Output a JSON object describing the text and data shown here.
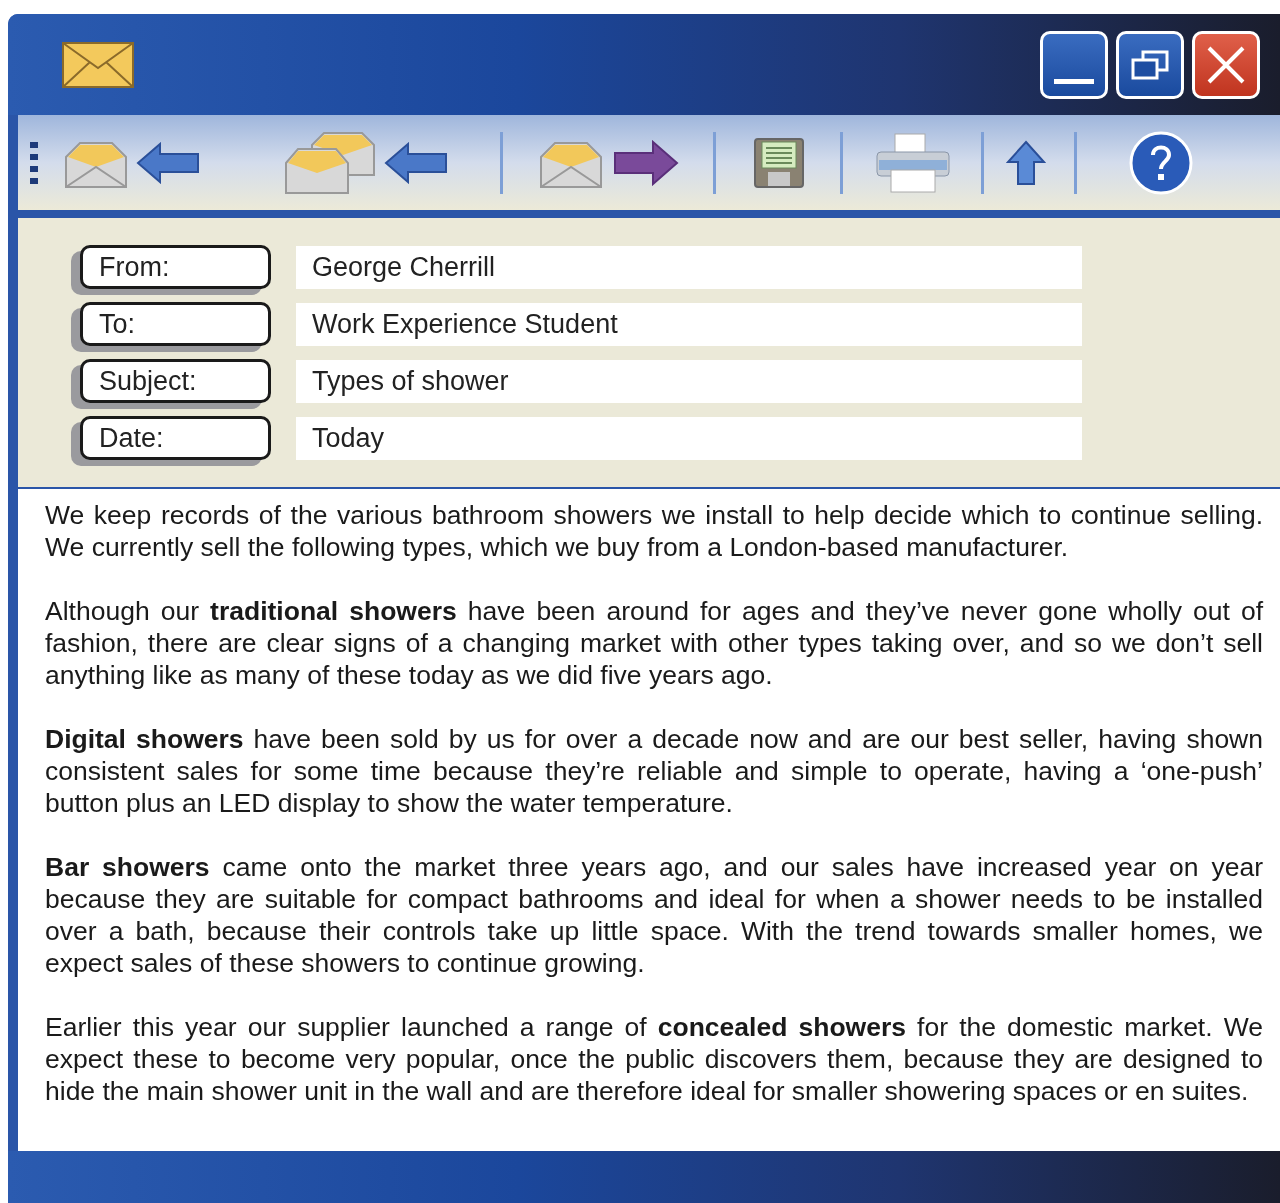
{
  "header_fields": [
    {
      "label": "From:",
      "value": "George Cherrill"
    },
    {
      "label": "To:",
      "value": "Work Experience Student"
    },
    {
      "label": "Subject:",
      "value": "Types of shower"
    },
    {
      "label": "Date:",
      "value": "Today"
    }
  ],
  "message": {
    "paragraphs": [
      "We keep records of the various bathroom showers we install to help decide which to continue selling. We currently sell the following types, which we buy from a London-based manufacturer.",
      "Although our **traditional showers** have been around for ages and they’ve never gone wholly out of fashion, there are clear signs of a changing market with other types taking over, and so we don’t sell anything like as many of these today as we did five years ago.",
      "**Digital showers** have been sold by us for over a decade now and are our best seller, having shown consistent sales for some time because they’re reliable and simple to operate, having a ‘one-push’ button plus an LED display to show the water temperature.",
      "**Bar showers** came onto the market three years ago, and our sales have increased year on year because they are suitable for compact bathrooms and ideal for when a shower needs to be installed over a bath, because their controls take up little space. With the trend towards smaller homes, we expect sales of these showers to continue growing.",
      "Earlier this year our supplier launched a range of **concealed showers** for the domestic market. We expect these to become very popular, once the public discovers them, because they are designed to hide the main shower unit in the wall and are therefore ideal for smaller showering spaces or en suites."
    ]
  }
}
